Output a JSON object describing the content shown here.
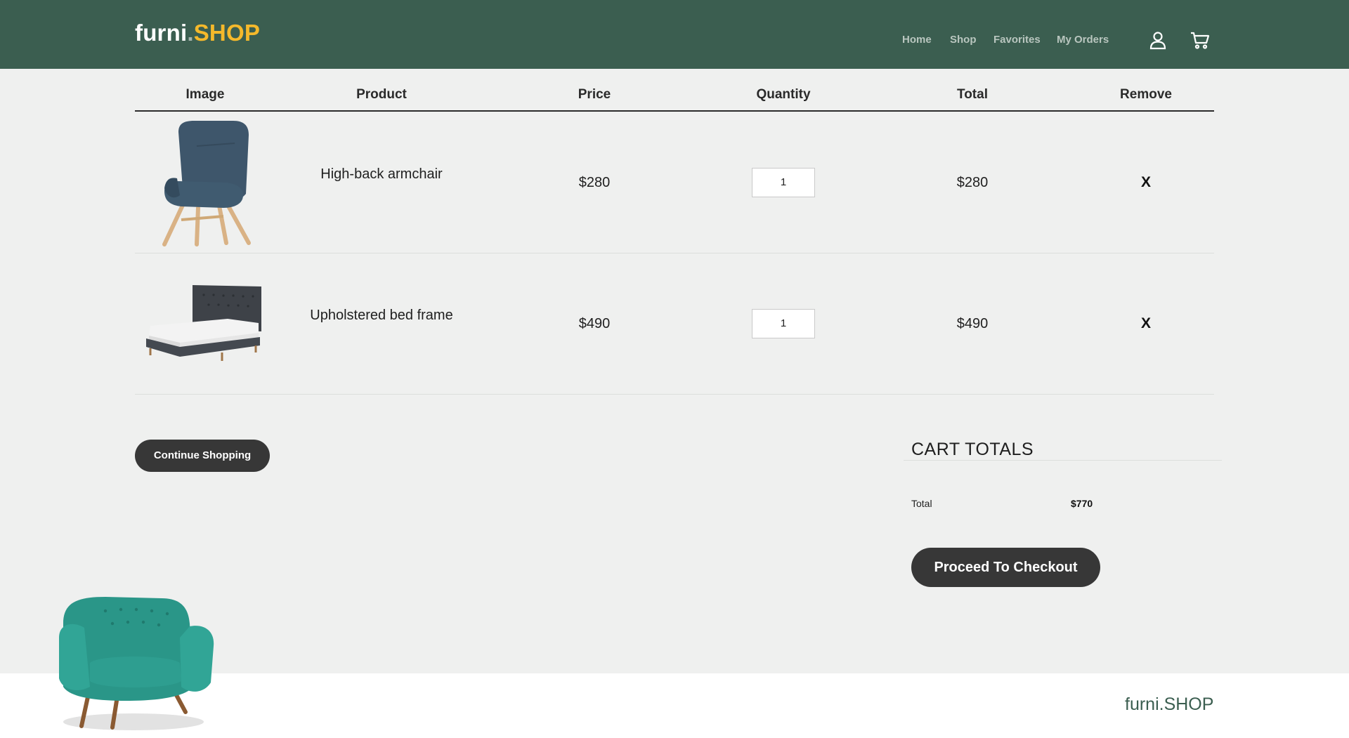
{
  "header": {
    "logo_main": "furni",
    "logo_dot": ".",
    "logo_accent": "SHOP",
    "nav": [
      "Home",
      "Shop",
      "Favorites",
      "My Orders"
    ],
    "icons": [
      "user-icon",
      "cart-icon"
    ]
  },
  "cart": {
    "columns": [
      "Image",
      "Product",
      "Price",
      "Quantity",
      "Total",
      "Remove"
    ],
    "items": [
      {
        "product": "High-back armchair",
        "price": "$280",
        "quantity": "1",
        "total": "$280",
        "remove": "X"
      },
      {
        "product": "Upholstered bed frame",
        "price": "$490",
        "quantity": "1",
        "total": "$490",
        "remove": "X"
      }
    ]
  },
  "actions": {
    "continue_shopping": "Continue Shopping",
    "checkout": "Proceed To Checkout"
  },
  "totals": {
    "title": "CART TOTALS",
    "label": "Total",
    "value": "$770"
  },
  "footer": {
    "logo": "furni.SHOP"
  },
  "colors": {
    "header_bg": "#3b5e50",
    "accent": "#f5b92b",
    "button_bg": "#373737",
    "page_bg": "#eff0ef"
  }
}
